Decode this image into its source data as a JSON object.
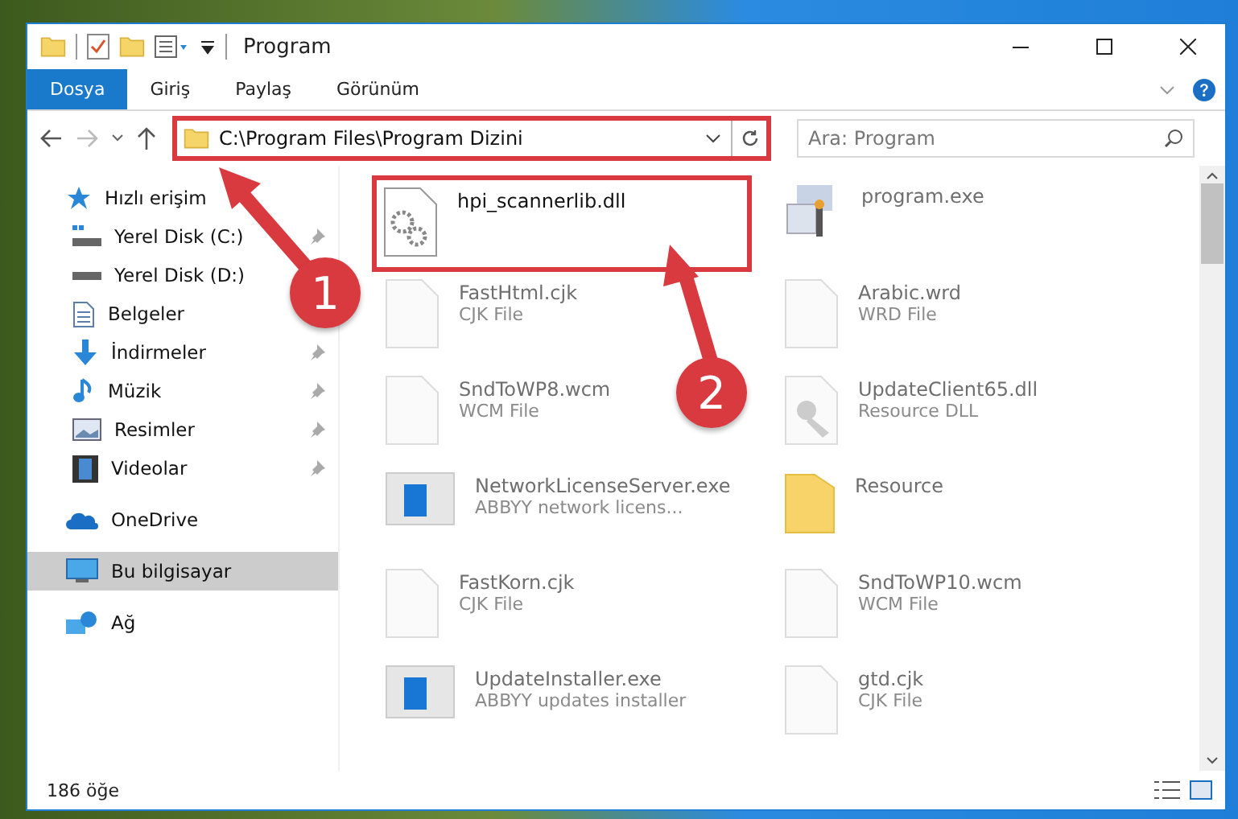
{
  "window": {
    "title": "Program"
  },
  "ribbon_tabs": [
    {
      "label": "Dosya",
      "selected": true
    },
    {
      "label": "Giriş",
      "selected": false
    },
    {
      "label": "Paylaş",
      "selected": false
    },
    {
      "label": "Görünüm",
      "selected": false
    }
  ],
  "address_bar": {
    "path": "C:\\Program Files\\Program Dizini",
    "highlighted": true
  },
  "search": {
    "placeholder": "Ara: Program"
  },
  "sidebar": {
    "items": [
      {
        "label": "Hızlı erişim",
        "kind": "star",
        "selected": false,
        "children": [
          {
            "label": "Yerel Disk (C:)",
            "kind": "drive-c",
            "pinned": true
          },
          {
            "label": "Yerel Disk (D:)",
            "kind": "drive",
            "pinned": false
          },
          {
            "label": "Belgeler",
            "kind": "documents",
            "pinned": false
          },
          {
            "label": "İndirmeler",
            "kind": "downloads",
            "pinned": true
          },
          {
            "label": "Müzik",
            "kind": "music",
            "pinned": true
          },
          {
            "label": "Resimler",
            "kind": "pictures",
            "pinned": true
          },
          {
            "label": "Videolar",
            "kind": "videos",
            "pinned": true
          }
        ]
      },
      {
        "label": "OneDrive",
        "kind": "cloud",
        "selected": false
      },
      {
        "label": "Bu bilgisayar",
        "kind": "computer",
        "selected": true
      },
      {
        "label": "Ağ",
        "kind": "network",
        "selected": false
      }
    ]
  },
  "files": [
    {
      "name": "hpi_scannerlib.dll",
      "kind": "gear",
      "highlighted": true,
      "dimmed": false
    },
    {
      "name": "program.exe",
      "kind": "setup",
      "highlighted": false,
      "dimmed": true
    },
    {
      "name": "FastHtml.cjk",
      "type": "CJK File",
      "kind": "doc",
      "highlighted": false,
      "dimmed": true
    },
    {
      "name": "Arabic.wrd",
      "type": "WRD File",
      "kind": "doc",
      "highlighted": false,
      "dimmed": true
    },
    {
      "name": "SndToWP8.wcm",
      "type": "WCM File",
      "kind": "doc",
      "highlighted": false,
      "dimmed": true
    },
    {
      "name": "UpdateClient65.dll",
      "type": "Resource DLL",
      "kind": "library",
      "highlighted": false,
      "dimmed": true
    },
    {
      "name": "NetworkLicenseServer.exe",
      "type": "ABBYY network licens...",
      "kind": "app",
      "highlighted": false,
      "dimmed": true
    },
    {
      "name": "Resource",
      "kind": "folder",
      "highlighted": false,
      "dimmed": true
    },
    {
      "name": "FastKorn.cjk",
      "type": "CJK File",
      "kind": "doc",
      "highlighted": false,
      "dimmed": true
    },
    {
      "name": "SndToWP10.wcm",
      "type": "WCM File",
      "kind": "doc",
      "highlighted": false,
      "dimmed": true
    },
    {
      "name": "UpdateInstaller.exe",
      "type": "ABBYY updates installer",
      "kind": "app",
      "highlighted": false,
      "dimmed": true
    },
    {
      "name": "gtd.cjk",
      "type": "CJK File",
      "kind": "doc",
      "highlighted": false,
      "dimmed": true
    }
  ],
  "status_bar": {
    "count": "186 öğe"
  },
  "annotations": [
    {
      "label": "1"
    },
    {
      "label": "2"
    }
  ]
}
